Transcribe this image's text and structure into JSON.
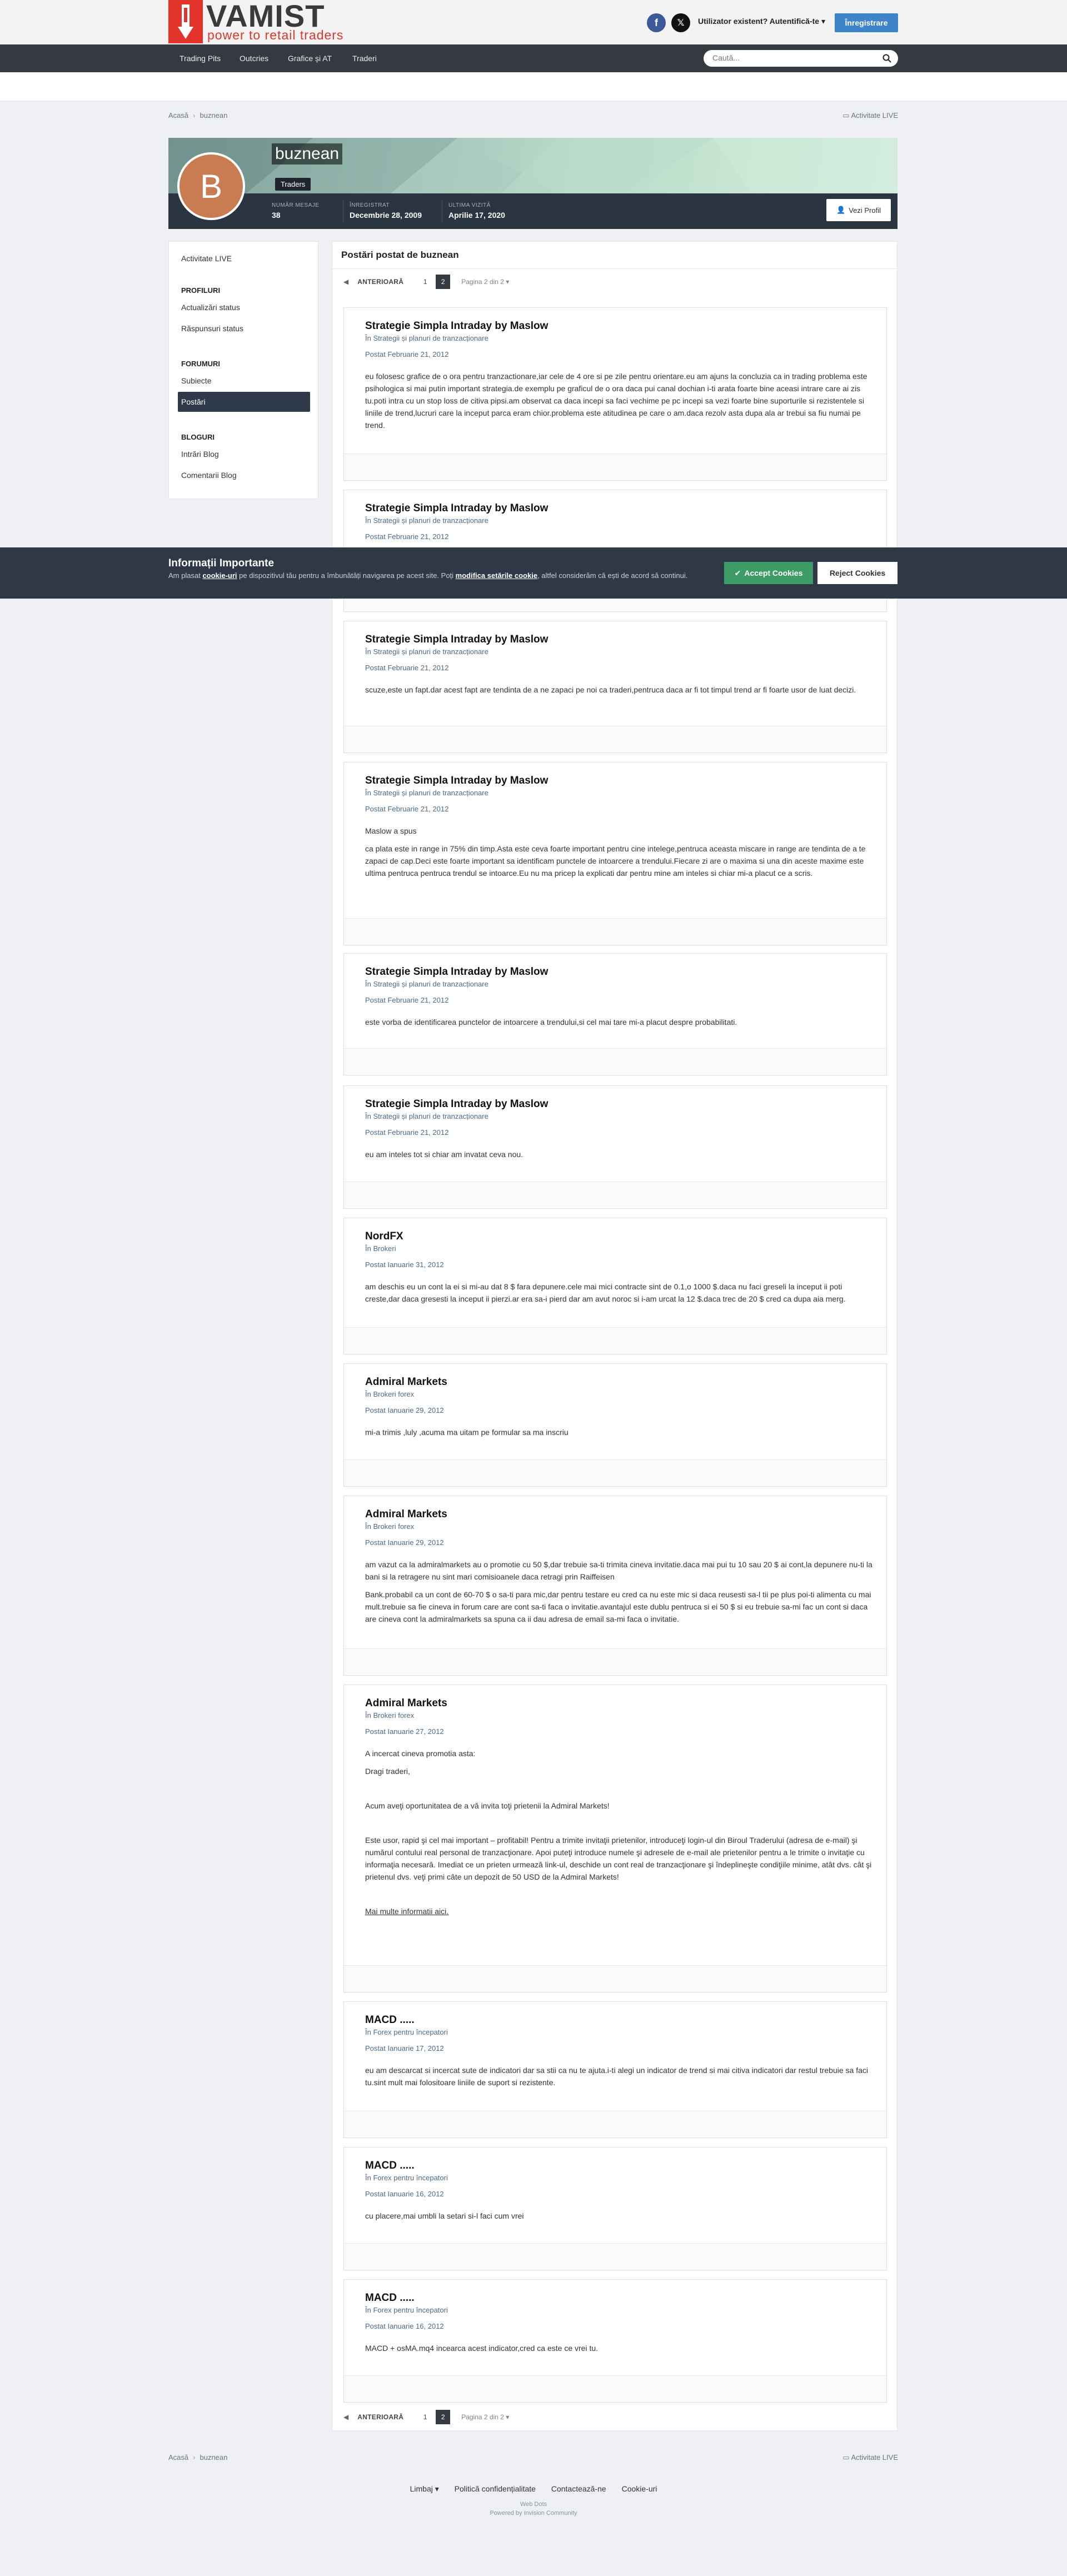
{
  "header": {
    "logo_word": "VAMIST",
    "logo_tagline": "power to retail traders",
    "signin_label": "Utilizator existent? Autentifică-te",
    "register_label": "Înregistrare"
  },
  "nav": {
    "items": [
      "Trading Pits",
      "Outcries",
      "Grafice și AT",
      "Traderi"
    ],
    "search_placeholder": "Caută..."
  },
  "breadcrumb": {
    "home": "Acasă",
    "current": "buznean"
  },
  "activity_label": "Activitate LIVE",
  "profile": {
    "avatar_letter": "B",
    "avatar_color": "#c97c52",
    "username": "buznean",
    "group": "Traders",
    "stats": [
      {
        "label": "Număr mesaje",
        "value": "38"
      },
      {
        "label": "Înregistrat",
        "value": "Decembrie 28, 2009"
      },
      {
        "label": "Ultima vizită",
        "value": "Aprilie 17, 2020"
      }
    ],
    "view_profile_label": "Vezi Profil"
  },
  "sidebar": {
    "activity": "Activitate LIVE",
    "profiles_head": "Profiluri",
    "status_updates": "Actualizări status",
    "status_replies": "Răspunsuri status",
    "forums_head": "Forumuri",
    "topics": "Subiecte",
    "posts": "Postări",
    "blogs_head": "Bloguri",
    "blog_entries": "Intrări Blog",
    "blog_comments": "Comentarii Blog"
  },
  "main": {
    "title": "Postări postat de buznean",
    "pager": {
      "prev": "ANTERIOARĂ",
      "page1": "1",
      "page2": "2",
      "page_of": "Pagina 2 din 2"
    }
  },
  "posts": [
    {
      "title": "Strategie Simpla Intraday by Maslow",
      "forum": "În Strategii și planuri de tranzacționare",
      "date": "Postat Februarie 21, 2012",
      "paragraphs": [
        "eu folosesc grafice de o ora pentru tranzactionare,iar cele de 4 ore si pe zile pentru orientare.eu am ajuns la concluzia ca in trading problema este psihologica si mai putin important strategia.de exemplu pe graficul de o ora daca pui canal dochian i-ti arata foarte bine aceasi intrare care ai zis tu.poti intra cu un stop loss de citiva pipsi.am observat ca daca incepi sa faci vechime pe pc incepi sa vezi foarte bine suporturile si rezistentele si liniile de trend,lucruri care la inceput parca eram chior.problema este atitudinea pe care o am.daca rezolv asta dupa ala ar trebui sa fiu numai pe trend."
      ]
    },
    {
      "title": "Strategie Simpla Intraday by Maslow",
      "forum": "În Strategii și planuri de tranzacționare",
      "date": "Postat Februarie 21, 2012",
      "paragraphs": []
    },
    {
      "title": "Strategie Simpla Intraday by Maslow",
      "forum": "În Strategii și planuri de tranzacționare",
      "date": "Postat Februarie 21, 2012",
      "paragraphs": [
        "scuze,este un fapt.dar acest fapt are tendinta de a ne zapaci pe noi ca traderi,pentruca daca ar fi tot timpul trend ar fi foarte usor de luat decizi."
      ]
    },
    {
      "title": "Strategie Simpla Intraday by Maslow",
      "forum": "În Strategii și planuri de tranzacționare",
      "date": "Postat Februarie 21, 2012",
      "paragraphs": [
        "Maslow a spus",
        "ca plata este in range in 75% din timp.Asta este ceva foarte important pentru cine intelege,pentruca aceasta miscare in range are tendinta de a te zapaci de cap.Deci este foarte important sa identificam punctele de intoarcere a trendului.Fiecare zi are o maxima si una din aceste maxime este ultima pentruca pentruca trendul se intoarce.Eu nu ma pricep la explicati dar pentru mine am inteles si chiar mi-a placut ce a scris."
      ]
    },
    {
      "title": "Strategie Simpla Intraday by Maslow",
      "forum": "În Strategii și planuri de tranzacționare",
      "date": "Postat Februarie 21, 2012",
      "paragraphs": [
        "este vorba de identificarea punctelor de intoarcere a trendului,si cel mai tare mi-a placut despre probabilitati."
      ]
    },
    {
      "title": "Strategie Simpla Intraday by Maslow",
      "forum": "În Strategii și planuri de tranzacționare",
      "date": "Postat Februarie 21, 2012",
      "paragraphs": [
        "eu am inteles tot si chiar am invatat ceva nou."
      ]
    },
    {
      "title": "NordFX",
      "forum": "În Brokeri",
      "date": "Postat Ianuarie 31, 2012",
      "paragraphs": [
        "am deschis eu un cont la ei si mi-au dat 8 $ fara depunere.cele mai mici contracte sint de 0.1,o 1000 $.daca nu faci greseli la inceput ii poti creste,dar daca gresesti la inceput ii pierzi.ar era sa-i pierd dar am avut noroc si i-am urcat la 12 $.daca trec de 20 $ cred ca dupa aia merg."
      ]
    },
    {
      "title": "Admiral Markets",
      "forum": "În Brokeri forex",
      "date": "Postat Ianuarie 29, 2012",
      "paragraphs": [
        "mi-a trimis ,luly ,acuma ma uitam pe formular sa ma inscriu"
      ]
    },
    {
      "title": "Admiral Markets",
      "forum": "În Brokeri forex",
      "date": "Postat Ianuarie 29, 2012",
      "paragraphs": [
        "am vazut ca la admiralmarkets au o promotie cu 50 $,dar trebuie sa-ti trimita cineva invitatie.daca mai pui tu 10 sau 20 $ ai cont,la depunere nu-ti la bani si la retragere nu sint mari comisioanele daca retragi prin Raiffeisen",
        "Bank.probabil ca un cont de 60-70 $ o sa-ti para mic,dar pentru testare eu cred ca nu este mic si daca reusesti sa-l tii pe plus poi-ti alimenta cu mai mult.trebuie sa fie cineva in forum care are cont sa-ti faca o invitatie.avantajul este dublu pentruca si ei 50 $ si eu trebuie sa-mi fac un cont si daca are cineva cont la admiralmarkets sa spuna ca ii dau adresa de email sa-mi faca o invitatie."
      ]
    },
    {
      "title": "Admiral Markets",
      "forum": "În Brokeri forex",
      "date": "Postat Ianuarie 27, 2012",
      "paragraphs": [
        "A incercat cineva promotia asta:",
        "Dragi traderi,",
        "Acum aveţi oportunitatea de a vă invita toţi prietenii la Admiral Markets!",
        "Este usor, rapid şi cel mai important – profitabil! Pentru a trimite invitaţii prietenilor, introduceţi login-ul din Biroul Traderului (adresa de e-mail) şi numărul contului real personal de tranzacţionare. Apoi puteţi introduce numele şi adresele de e-mail ale prietenilor pentru a le trimite o invitaţie cu informaţia necesară. Imediat ce un prieten urmează link-ul, deschide un cont real de tranzacţionare şi îndeplineşte condiţiile minime, atât dvs. cât şi prietenul dvs. veţi primi câte un depozit de 50 USD de la Admiral Markets!",
        "Mai multe informatii aici."
      ]
    },
    {
      "title": "MACD .....",
      "forum": "În Forex pentru începatori",
      "date": "Postat Ianuarie 17, 2012",
      "paragraphs": [
        "eu am descarcat si incercat sute de indicatori dar sa stii ca nu te ajuta.i-ti alegi un indicator de trend si mai citiva indicatori dar restul trebuie sa faci tu.sint mult mai folositoare liniile de suport si rezistente."
      ]
    },
    {
      "title": "MACD .....",
      "forum": "În Forex pentru începatori",
      "date": "Postat Ianuarie 16, 2012",
      "paragraphs": [
        "cu placere,mai umbli la setari si-l faci cum vrei"
      ]
    },
    {
      "title": "MACD .....",
      "forum": "În Forex pentru începatori",
      "date": "Postat Ianuarie 16, 2012",
      "paragraphs": [
        "MACD + osMA.mq4 incearca acest indicator,cred ca este ce vrei tu."
      ]
    }
  ],
  "cookie": {
    "title": "Informații Importante",
    "text_a": "Am plasat ",
    "link_cookies": "cookie-uri",
    "text_b": " pe dispozitivul tău pentru a îmbunătăți navigarea pe acest site. Poți ",
    "link_settings": "modifica setările cookie",
    "text_c": ", altfel considerăm că ești de acord să continui.",
    "accept_label": "Accept Cookies",
    "reject_label": "Reject Cookies"
  },
  "footer": {
    "language": "Limbaj",
    "privacy": "Politică confidențialitate",
    "contact": "Contactează-ne",
    "cookies": "Cookie-uri",
    "web_dots": "Web Dots",
    "powered": "Powered by Invision Community"
  },
  "colors": {
    "accent": "#3d84c9",
    "brand_red": "#e2342b",
    "nav_bg": "#353a40",
    "accept_green": "#3d9b67"
  }
}
